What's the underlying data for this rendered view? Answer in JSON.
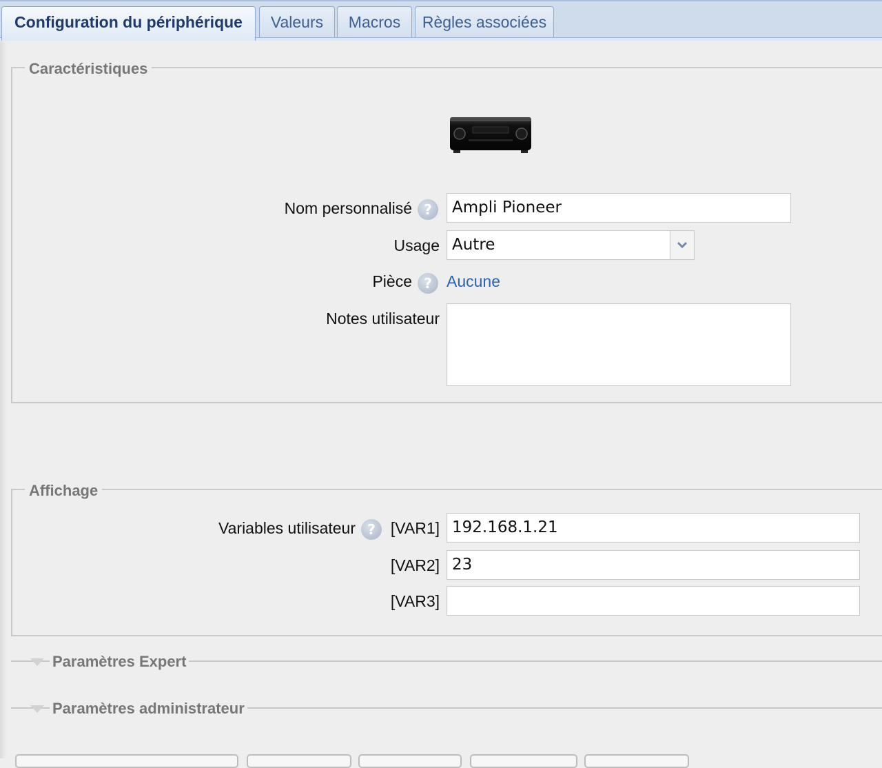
{
  "tabs": {
    "config": "Configuration du périphérique",
    "values": "Valeurs",
    "macros": "Macros",
    "rules": "Règles associées"
  },
  "characteristics": {
    "legend": "Caractéristiques",
    "device_icon": "av-receiver-icon",
    "name_label": "Nom personnalisé",
    "name_value": "Ampli Pioneer",
    "usage_label": "Usage",
    "usage_value": "Autre",
    "room_label": "Pièce",
    "room_value": "Aucune",
    "notes_label": "Notes utilisateur",
    "notes_value": ""
  },
  "display": {
    "legend": "Affichage",
    "vars_label": "Variables utilisateur",
    "vars": [
      {
        "tag": "[VAR1]",
        "value": "192.168.1.21"
      },
      {
        "tag": "[VAR2]",
        "value": "23"
      },
      {
        "tag": "[VAR3]",
        "value": ""
      }
    ]
  },
  "sections": {
    "expert": "Paramètres Expert",
    "admin": "Paramètres administrateur"
  },
  "help_glyph": "?",
  "colors": {
    "tab_bar": "#cfdcec",
    "active_tab_text": "#1e3a6e",
    "link": "#2a63b8",
    "legend_text": "#777777",
    "background": "#eeeeee"
  }
}
